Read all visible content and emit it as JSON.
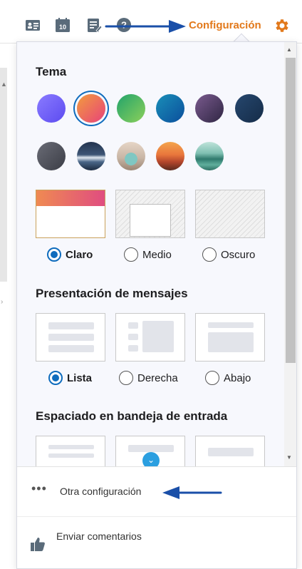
{
  "toolbar": {
    "icons": [
      "contact-card-icon",
      "calendar-icon",
      "notes-icon",
      "help-icon"
    ],
    "calendar_day": "10",
    "settings_label": "Configuración",
    "accent_color": "#e2791b"
  },
  "theme": {
    "title": "Tema",
    "swatches": [
      {
        "name": "violeta",
        "selected": false
      },
      {
        "name": "naranja-rosa",
        "selected": true
      },
      {
        "name": "verde",
        "selected": false
      },
      {
        "name": "azul",
        "selected": false
      },
      {
        "name": "morado-oscuro",
        "selected": false
      },
      {
        "name": "azul-marino",
        "selected": false
      },
      {
        "name": "gris",
        "selected": false
      },
      {
        "name": "montaña",
        "selected": false
      },
      {
        "name": "autobús",
        "selected": false
      },
      {
        "name": "atardecer",
        "selected": false
      },
      {
        "name": "lago",
        "selected": false
      }
    ],
    "modes": [
      {
        "label": "Claro",
        "checked": true
      },
      {
        "label": "Medio",
        "checked": false
      },
      {
        "label": "Oscuro",
        "checked": false
      }
    ]
  },
  "layout": {
    "title": "Presentación de mensajes",
    "options": [
      {
        "label": "Lista",
        "checked": true
      },
      {
        "label": "Derecha",
        "checked": false
      },
      {
        "label": "Abajo",
        "checked": false
      }
    ]
  },
  "spacing": {
    "title": "Espaciado en bandeja de entrada"
  },
  "footer": {
    "more_label": "Otra configuración",
    "feedback_label": "Enviar comentarios"
  },
  "colors": {
    "selected_blue": "#0f6cbd",
    "panel_bg": "#f7f8fd"
  }
}
